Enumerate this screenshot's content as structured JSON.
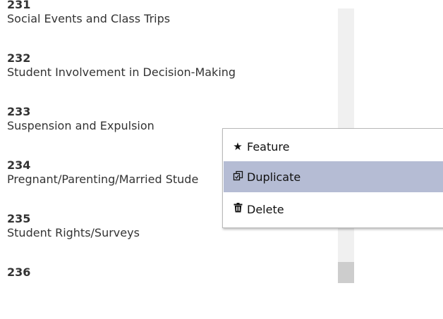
{
  "list": {
    "items": [
      {
        "number": "231",
        "title": "Social Events and Class Trips"
      },
      {
        "number": "232",
        "title": "Student Involvement in Decision-Making"
      },
      {
        "number": "233",
        "title": "Suspension and Expulsion"
      },
      {
        "number": "234",
        "title": "Pregnant/Parenting/Married Stude"
      },
      {
        "number": "235",
        "title": "Student Rights/Surveys"
      },
      {
        "number": "236",
        "title": ""
      }
    ]
  },
  "context_menu": {
    "feature_label": "Feature",
    "feature_icon": "star-icon",
    "duplicate_label": "Duplicate",
    "duplicate_icon": "duplicate-icon",
    "delete_label": "Delete",
    "delete_icon": "trash-icon",
    "highlight_color": "#b5bcd4"
  }
}
